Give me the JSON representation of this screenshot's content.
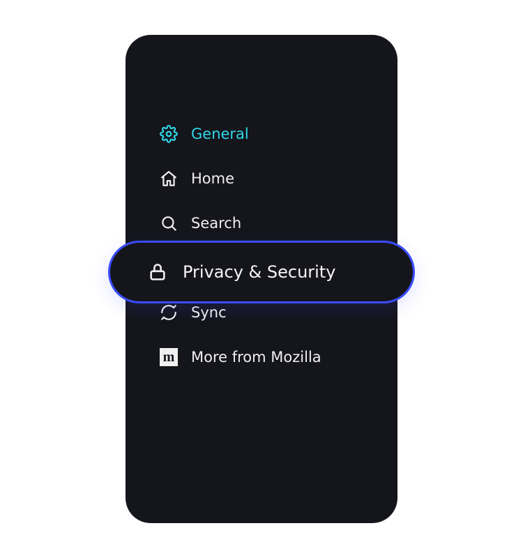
{
  "sidebar": {
    "items": [
      {
        "label": "General",
        "icon": "gear",
        "active": true
      },
      {
        "label": "Home",
        "icon": "home",
        "active": false
      },
      {
        "label": "Search",
        "icon": "search",
        "active": false
      },
      {
        "label": "Privacy & Security",
        "icon": "lock",
        "active": false,
        "highlighted": true
      },
      {
        "label": "Sync",
        "icon": "sync",
        "active": false
      },
      {
        "label": "More from Mozilla",
        "icon": "mozilla",
        "active": false
      }
    ]
  },
  "colors": {
    "accent": "#2fd6e8",
    "highlight_ring": "#3a4cff",
    "panel_bg": "#15151c",
    "text": "#f0f0f0"
  }
}
